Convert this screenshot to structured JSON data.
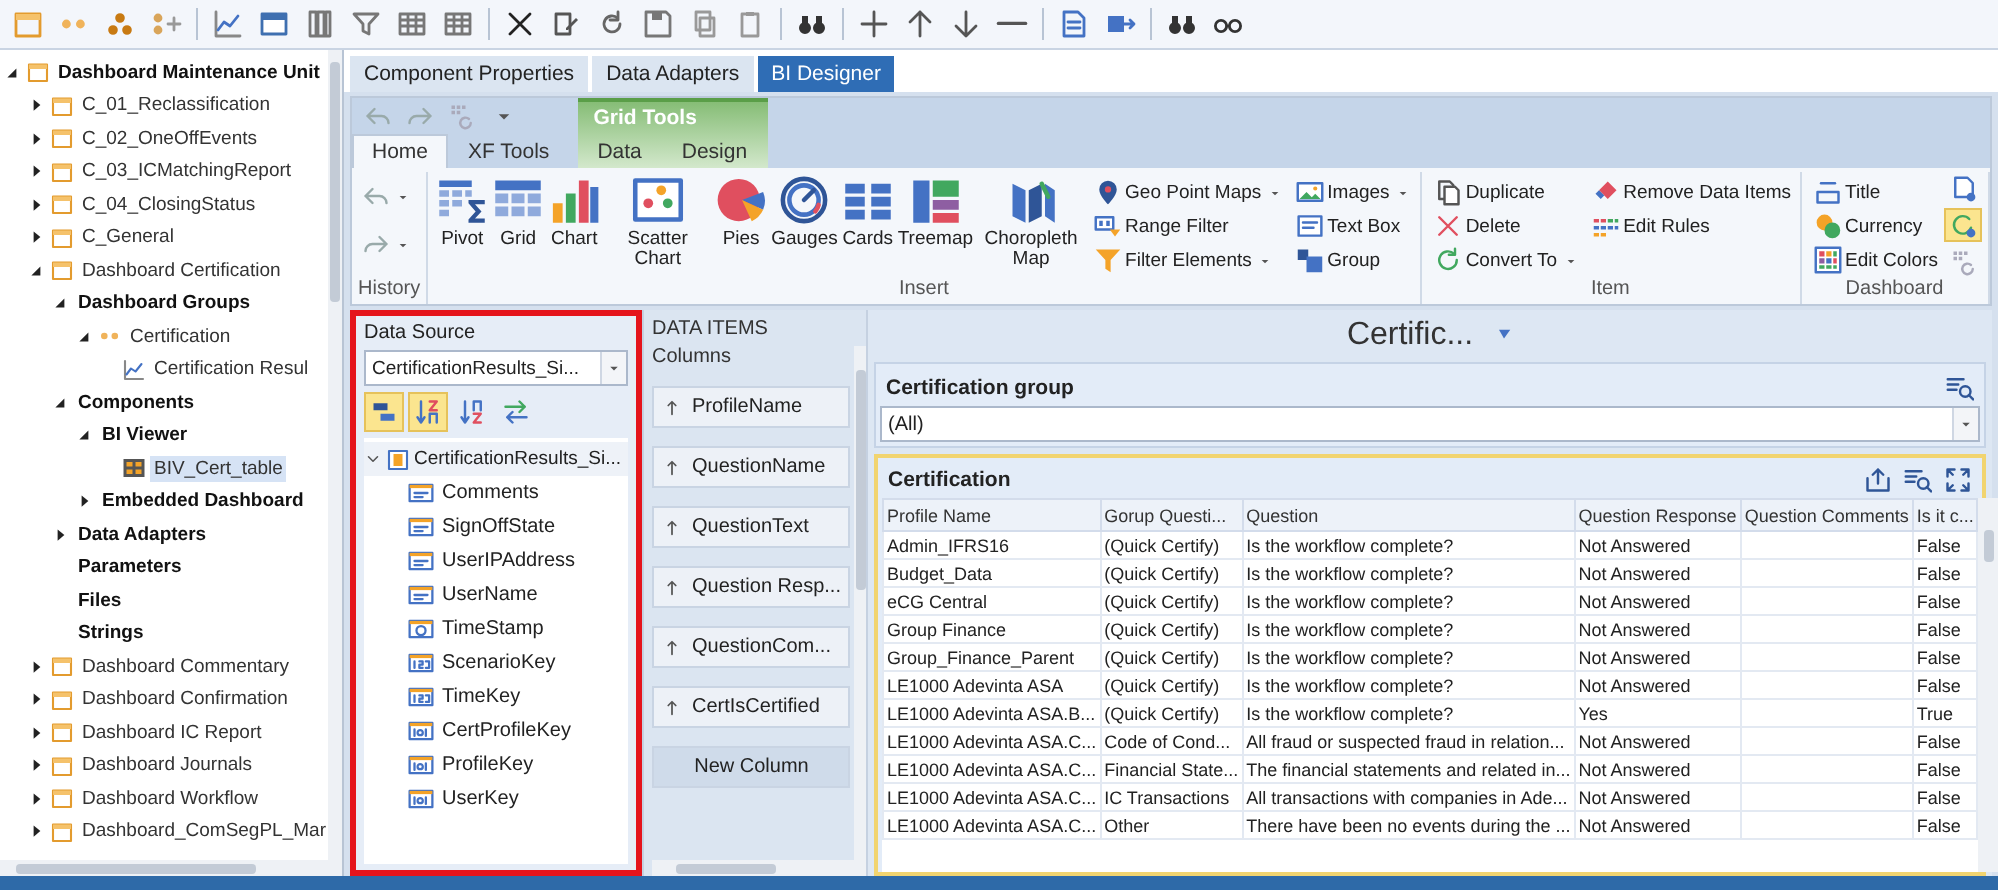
{
  "tree": {
    "items": [
      {
        "label": "Dashboard Maintenance Unit",
        "kind": "unit",
        "expanded": true,
        "selected": false,
        "children": [
          {
            "label": "C_01_Reclassification",
            "kind": "dashboard",
            "expanded": false,
            "selected": false
          },
          {
            "label": "C_02_OneOffEvents",
            "kind": "dashboard",
            "expanded": false,
            "selected": false
          },
          {
            "label": "C_03_ICMatchingReport",
            "kind": "dashboard",
            "expanded": false,
            "selected": false
          },
          {
            "label": "C_04_ClosingStatus",
            "kind": "dashboard",
            "expanded": false,
            "selected": false
          },
          {
            "label": "C_General",
            "kind": "dashboard",
            "expanded": false,
            "selected": false
          },
          {
            "label": "Dashboard Certification",
            "kind": "dashboard",
            "expanded": true,
            "selected": false,
            "children": [
              {
                "label": "Dashboard Groups",
                "kind": "section",
                "expanded": true,
                "selected": false,
                "children": [
                  {
                    "label": "Certification",
                    "kind": "group",
                    "expanded": true,
                    "selected": false,
                    "children": [
                      {
                        "label": "Certification Resul",
                        "kind": "chart",
                        "selected": false
                      }
                    ]
                  }
                ]
              },
              {
                "label": "Components",
                "kind": "section",
                "expanded": true,
                "selected": false,
                "children": [
                  {
                    "label": "BI Viewer",
                    "kind": "section",
                    "expanded": true,
                    "selected": false,
                    "children": [
                      {
                        "label": "BIV_Cert_table",
                        "kind": "component",
                        "selected": true
                      }
                    ]
                  },
                  {
                    "label": "Embedded Dashboard",
                    "kind": "section",
                    "expanded": false,
                    "selected": false
                  }
                ]
              },
              {
                "label": "Data Adapters",
                "kind": "section",
                "expanded": false,
                "selected": false
              },
              {
                "label": "Parameters",
                "kind": "section",
                "selected": false
              },
              {
                "label": "Files",
                "kind": "section",
                "selected": false
              },
              {
                "label": "Strings",
                "kind": "section",
                "selected": false
              }
            ]
          },
          {
            "label": "Dashboard Commentary",
            "kind": "dashboard",
            "expanded": false,
            "selected": false
          },
          {
            "label": "Dashboard Confirmation",
            "kind": "dashboard",
            "expanded": false,
            "selected": false
          },
          {
            "label": "Dashboard IC Report",
            "kind": "dashboard",
            "expanded": false,
            "selected": false
          },
          {
            "label": "Dashboard Journals",
            "kind": "dashboard",
            "expanded": false,
            "selected": false
          },
          {
            "label": "Dashboard Workflow",
            "kind": "dashboard",
            "expanded": false,
            "selected": false
          },
          {
            "label": "Dashboard_ComSegPL_Mar",
            "kind": "dashboard",
            "expanded": false,
            "selected": false
          }
        ]
      }
    ]
  },
  "doc_tabs": [
    {
      "label": "Component Properties",
      "selected": false
    },
    {
      "label": "Data Adapters",
      "selected": false
    },
    {
      "label": "BI Designer",
      "selected": true
    }
  ],
  "ribbon": {
    "context_label": "Grid Tools",
    "tabs": [
      {
        "label": "Home",
        "kind": "normal",
        "selected": true
      },
      {
        "label": "XF Tools",
        "kind": "normal",
        "selected": false
      },
      {
        "label": "Data",
        "kind": "contextual",
        "selected": false
      },
      {
        "label": "Design",
        "kind": "contextual",
        "selected": false
      }
    ],
    "groups": [
      {
        "label": "History",
        "kind": "history"
      },
      {
        "label": "Insert",
        "kind": "insert",
        "buttons": [
          {
            "label": "Pivot"
          },
          {
            "label": "Grid"
          },
          {
            "label": "Chart"
          },
          {
            "label": "Scatter Chart"
          },
          {
            "label": "Pies"
          },
          {
            "label": "Gauges"
          },
          {
            "label": "Cards"
          },
          {
            "label": "Treemap"
          },
          {
            "label": "Choropleth Map"
          }
        ],
        "items": [
          {
            "label": "Geo Point Maps",
            "dropdown": true
          },
          {
            "label": "Range Filter",
            "dropdown": false
          },
          {
            "label": "Filter Elements",
            "dropdown": true
          },
          {
            "label": "Images",
            "dropdown": true
          },
          {
            "label": "Text Box",
            "dropdown": false
          },
          {
            "label": "Group",
            "dropdown": false
          }
        ]
      },
      {
        "label": "Item",
        "kind": "item",
        "items": [
          {
            "label": "Duplicate",
            "dropdown": false
          },
          {
            "label": "Delete",
            "dropdown": false
          },
          {
            "label": "Convert To",
            "dropdown": true
          },
          {
            "label": "Remove Data Items",
            "dropdown": false
          },
          {
            "label": "Edit Rules",
            "dropdown": false
          }
        ]
      },
      {
        "label": "Dashboard",
        "kind": "dashboard",
        "items": [
          {
            "label": "Title",
            "dropdown": false
          },
          {
            "label": "Currency",
            "dropdown": false
          },
          {
            "label": "Edit Colors",
            "dropdown": false
          }
        ],
        "toggles": [
          {
            "on": false
          },
          {
            "on": true
          },
          {
            "on": false
          }
        ]
      }
    ]
  },
  "data_source": {
    "label": "Data Source",
    "value": "CertificationResults_Si...",
    "highlighted": true,
    "tools": [
      {
        "on": true
      },
      {
        "on": true
      },
      {
        "on": false
      },
      {
        "on": false
      }
    ],
    "root": {
      "label": "CertificationResults_Si...",
      "expanded": true
    },
    "fields": [
      {
        "label": "Comments",
        "kind": "text"
      },
      {
        "label": "SignOffState",
        "kind": "text"
      },
      {
        "label": "UserIPAddress",
        "kind": "text"
      },
      {
        "label": "UserName",
        "kind": "text"
      },
      {
        "label": "TimeStamp",
        "kind": "datetime"
      },
      {
        "label": "ScenarioKey",
        "kind": "integer"
      },
      {
        "label": "TimeKey",
        "kind": "integer"
      },
      {
        "label": "CertProfileKey",
        "kind": "decimal"
      },
      {
        "label": "ProfileKey",
        "kind": "decimal"
      },
      {
        "label": "UserKey",
        "kind": "decimal"
      }
    ]
  },
  "data_items": {
    "title": "DATA ITEMS",
    "section": "Columns",
    "items": [
      {
        "label": "ProfileName",
        "kind": "column"
      },
      {
        "label": "QuestionName",
        "kind": "column"
      },
      {
        "label": "QuestionText",
        "kind": "column"
      },
      {
        "label": "Question Resp...",
        "kind": "column"
      },
      {
        "label": "QuestionCom...",
        "kind": "column"
      },
      {
        "label": "CertIsCertified",
        "kind": "column"
      },
      {
        "label": "New Column",
        "kind": "new"
      }
    ]
  },
  "dashboard": {
    "title": "Certific...",
    "filter": {
      "title": "Certification group",
      "value": "(All)"
    },
    "grid": {
      "title": "Certification",
      "selected": true,
      "columns": [
        "Profile Name",
        "Gorup Questi...",
        "Question",
        "Question Response",
        "Question Comments",
        "Is it c..."
      ],
      "rows": [
        {
          "profile_name": "Admin_IFRS16",
          "group_question": "(Quick Certify)",
          "question": "Is the workflow complete?",
          "response": "Not Answered",
          "column_6": "False"
        },
        {
          "profile_name": "Budget_Data",
          "group_question": "(Quick Certify)",
          "question": "Is the workflow complete?",
          "response": "Not Answered",
          "column_6": "False"
        },
        {
          "profile_name": "eCG Central",
          "group_question": "(Quick Certify)",
          "question": "Is the workflow complete?",
          "response": "Not Answered",
          "column_6": "False"
        },
        {
          "profile_name": "Group Finance",
          "group_question": "(Quick Certify)",
          "question": "Is the workflow complete?",
          "response": "Not Answered",
          "column_6": "False"
        },
        {
          "profile_name": "Group_Finance_Parent",
          "group_question": "(Quick Certify)",
          "question": "Is the workflow complete?",
          "response": "Not Answered",
          "column_6": "False"
        },
        {
          "profile_name": "LE1000 Adevinta ASA",
          "group_question": "(Quick Certify)",
          "question": "Is the workflow complete?",
          "response": "Not Answered",
          "column_6": "False"
        },
        {
          "profile_name": "LE1000 Adevinta ASA.B...",
          "group_question": "(Quick Certify)",
          "question": "Is the workflow complete?",
          "response": "Yes",
          "column_6": "True"
        },
        {
          "profile_name": "LE1000 Adevinta ASA.C...",
          "group_question": "Code of Cond...",
          "question": "All fraud or suspected fraud in relation...",
          "response": "Not Answered",
          "column_6": "False"
        },
        {
          "profile_name": "LE1000 Adevinta ASA.C...",
          "group_question": "Financial State...",
          "question": "The financial statements and related in...",
          "response": "Not Answered",
          "column_6": "False"
        },
        {
          "profile_name": "LE1000 Adevinta ASA.C...",
          "group_question": "IC Transactions",
          "question": "All transactions with companies in Ade...",
          "response": "Not Answered",
          "column_6": "False"
        },
        {
          "profile_name": "LE1000 Adevinta ASA.C...",
          "group_question": "Other",
          "question": "There have been no events during the ...",
          "response": "Not Answered",
          "column_6": "False"
        }
      ]
    }
  }
}
